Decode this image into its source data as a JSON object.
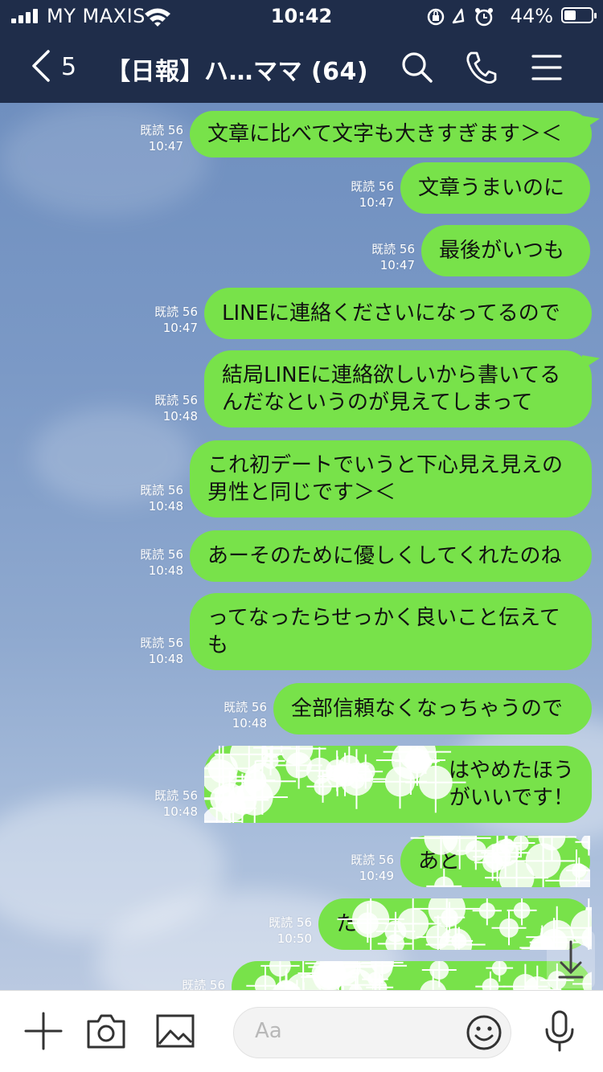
{
  "status": {
    "carrier": "MY MAXIS",
    "time": "10:42",
    "battery_pct": "44%",
    "battery_level": 0.44,
    "signal_bars": 4
  },
  "header": {
    "back_count": "5",
    "title": "【日報】ハ…ママ (64)"
  },
  "messages": [
    {
      "read": "既読 56",
      "time": "10:47",
      "lines": [
        "文章に比べて文字も大きすぎます＞＜"
      ],
      "obscured": false
    },
    {
      "read": "既読 56",
      "time": "10:47",
      "lines": [
        "文章うまいのに"
      ],
      "obscured": false
    },
    {
      "read": "既読 56",
      "time": "10:47",
      "lines": [
        "最後がいつも"
      ],
      "obscured": false
    },
    {
      "read": "既読 56",
      "time": "10:47",
      "lines": [
        "LINEに連絡くださいになってるので"
      ],
      "obscured": false
    },
    {
      "read": "既読 56",
      "time": "10:48",
      "lines": [
        "結局LINEに連絡欲しいから書いてる",
        "んだなというのが見えてしまって"
      ],
      "obscured": false
    },
    {
      "read": "既読 56",
      "time": "10:48",
      "lines": [
        "これ初デートでいうと下心見え見えの",
        "男性と同じです＞＜"
      ],
      "obscured": false
    },
    {
      "read": "既読 56",
      "time": "10:48",
      "lines": [
        "あーそのために優しくしてくれたのね"
      ],
      "obscured": false
    },
    {
      "read": "既読 56",
      "time": "10:48",
      "lines": [
        "ってなったらせっかく良いこと伝えて",
        "も"
      ],
      "obscured": false
    },
    {
      "read": "既読 56",
      "time": "10:48",
      "lines": [
        "全部信頼なくなっちゃうので"
      ],
      "obscured": false
    },
    {
      "read": "既読 56",
      "time": "10:48",
      "lines": [
        "はやめたほう",
        "がいいです！"
      ],
      "obscured": true
    },
    {
      "read": "既読 56",
      "time": "10:49",
      "lines": [
        "あと"
      ],
      "obscured": true
    },
    {
      "read": "既読 56",
      "time": "10:50",
      "lines": [
        "た"
      ],
      "obscured": true
    },
    {
      "read": "既読 56",
      "time": "",
      "lines": [
        ""
      ],
      "obscured": true
    }
  ],
  "composer": {
    "placeholder": "Aa"
  },
  "icons": {
    "back": "chevron-left-icon",
    "search": "search-icon",
    "call": "phone-icon",
    "menu": "hamburger-menu-icon",
    "add": "plus-icon",
    "camera": "camera-icon",
    "image": "image-icon",
    "emoji": "smiley-icon",
    "voice": "microphone-icon",
    "scroll": "arrow-down-icon"
  },
  "colors": {
    "header_bg": "#1f2d4a",
    "bubble": "#78e24a",
    "chat_bg": "#7b99c6"
  }
}
